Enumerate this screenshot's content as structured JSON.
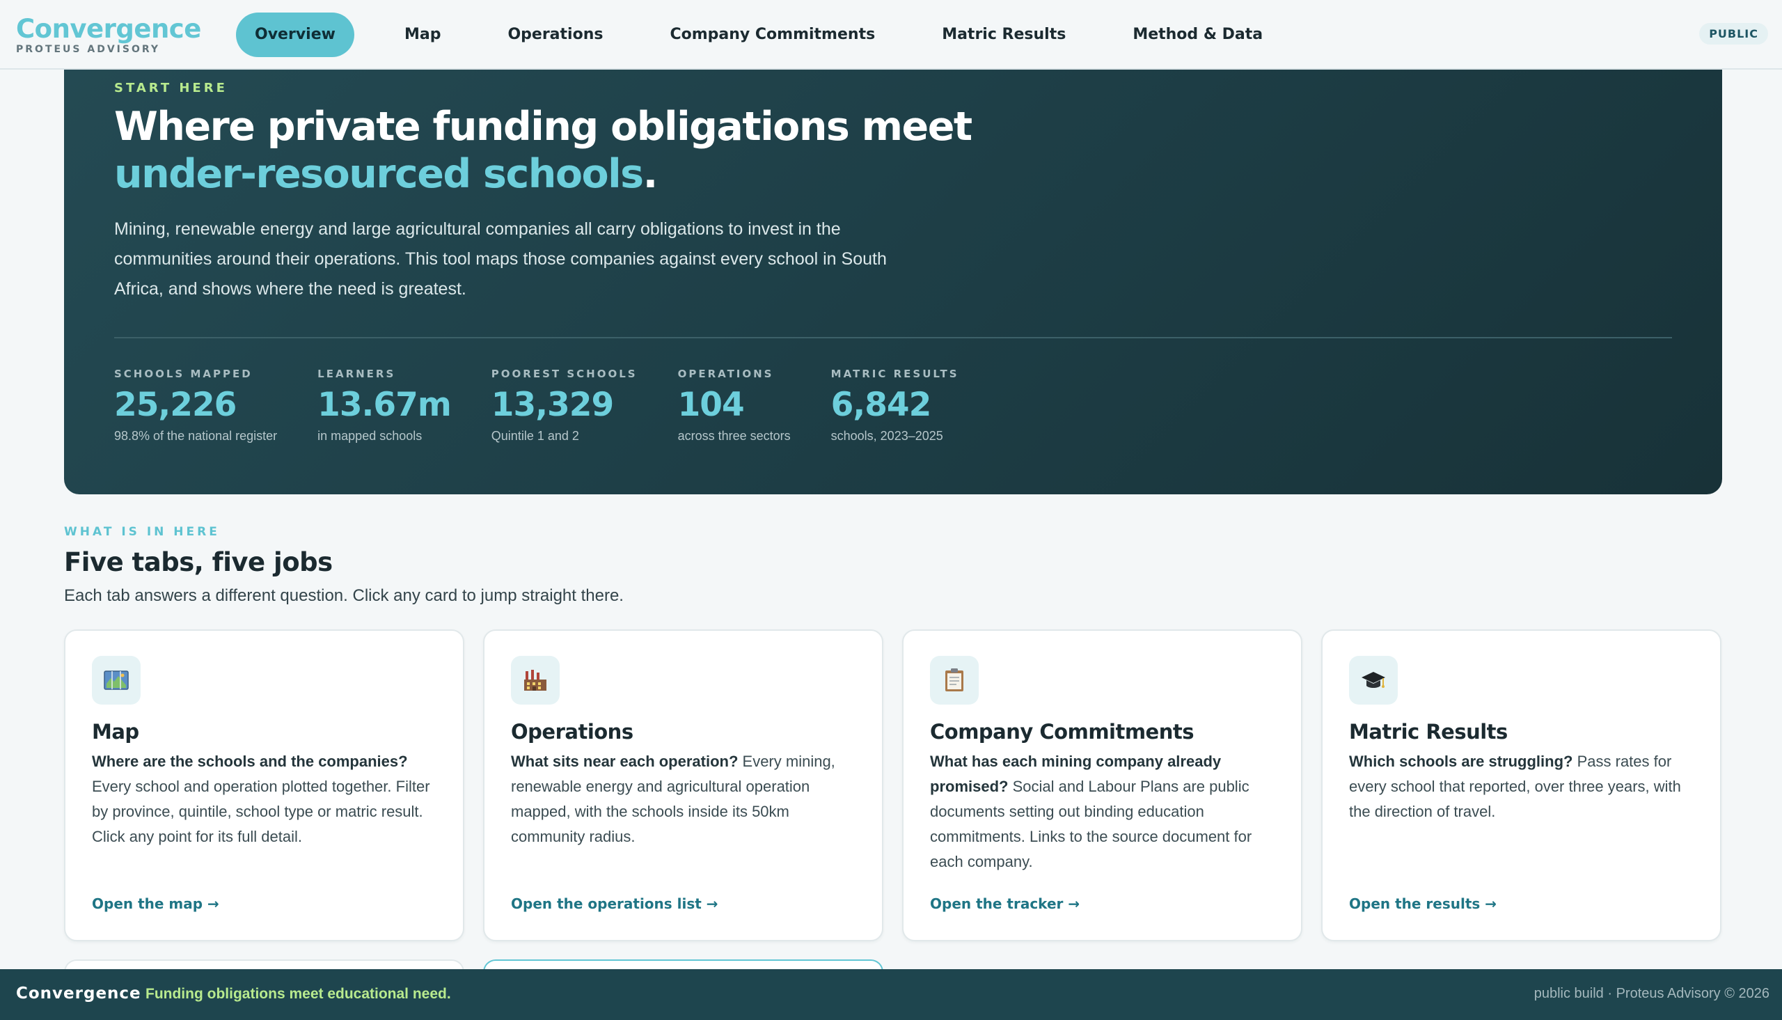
{
  "brand": {
    "name": "Convergence",
    "subtitle": "PROTEUS ADVISORY"
  },
  "nav": {
    "tabs": [
      {
        "label": "Overview",
        "active": true
      },
      {
        "label": "Map"
      },
      {
        "label": "Operations"
      },
      {
        "label": "Company Commitments"
      },
      {
        "label": "Matric Results"
      },
      {
        "label": "Method & Data"
      }
    ],
    "badge": "PUBLIC"
  },
  "hero": {
    "kicker": "START HERE",
    "title_line1": "Where private funding obligations meet",
    "title_accent": "under-resourced schools",
    "title_end": ".",
    "lede": "Mining, renewable energy and large agricultural companies all carry obligations to invest in the communities around their operations. This tool maps those companies against every school in South Africa, and shows where the need is greatest.",
    "stats": [
      {
        "label": "SCHOOLS MAPPED",
        "value": "25,226",
        "caption": "98.8% of the national register"
      },
      {
        "label": "LEARNERS",
        "value": "13.67m",
        "caption": "in mapped schools"
      },
      {
        "label": "POOREST SCHOOLS",
        "value": "13,329",
        "caption": "Quintile 1 and 2"
      },
      {
        "label": "OPERATIONS",
        "value": "104",
        "caption": "across three sectors"
      },
      {
        "label": "MATRIC RESULTS",
        "value": "6,842",
        "caption": "schools, 2023–2025"
      }
    ]
  },
  "section": {
    "kicker": "WHAT IS IN HERE",
    "title": "Five tabs, five jobs",
    "subtitle": "Each tab answers a different question. Click any card to jump straight there."
  },
  "cards": [
    {
      "icon": "map-icon",
      "title": "Map",
      "question": "Where are the schools and the companies?",
      "body": " Every school and operation plotted together. Filter by province, quintile, school type or matric result. Click any point for its full detail.",
      "link": "Open the map →"
    },
    {
      "icon": "factory-icon",
      "title": "Operations",
      "question": "What sits near each operation?",
      "body": " Every mining, renewable energy and agricultural operation mapped, with the schools inside its 50km community radius.",
      "link": "Open the operations list →"
    },
    {
      "icon": "clipboard-icon",
      "title": "Company Commitments",
      "question": "What has each mining company already promised?",
      "body": " Social and Labour Plans are public documents setting out binding education commitments. Links to the source document for each company.",
      "link": "Open the tracker →"
    },
    {
      "icon": "graduation-cap-icon",
      "title": "Matric Results",
      "question": "Which schools are struggling?",
      "body": " Pass rates for every school that reported, over three years, with the direction of travel.",
      "link": "Open the results →"
    }
  ],
  "footer": {
    "brand": "Convergence",
    "tagline": "Funding obligations meet educational need.",
    "right": "public build · Proteus Advisory © 2026"
  },
  "colors": {
    "accent": "#5ec3d1",
    "hero_bg": "#1d3d45",
    "kicker_green": "#b8ea8e",
    "footer_bg": "#1e454e"
  }
}
